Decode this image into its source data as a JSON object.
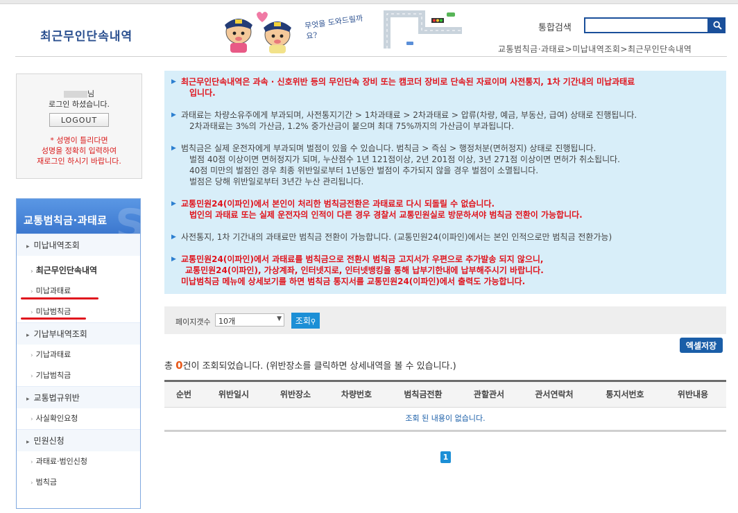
{
  "header": {
    "page_title": "최근무인단속내역",
    "search_label": "통합검색",
    "search_value": "",
    "mascot_text": "무엇을 도와드릴까요?",
    "breadcrumb": "교통범칙금·과태료>미납내역조회>최근무인단속내역"
  },
  "login": {
    "name_suffix": "님",
    "status": "로그인 하셨습니다.",
    "logout_label": "LOGOUT",
    "warning_lines": [
      "* 성명이 틀리다면",
      "성명을 정확히 입력하여",
      "재로그인 하시기 바랍니다."
    ]
  },
  "sidebar": {
    "title": "교통범칙금·과태료",
    "sections": [
      {
        "label": "미납내역조회",
        "items": [
          "최근무인단속내역",
          "미납과태료",
          "미납범칙금"
        ]
      },
      {
        "label": "기납부내역조회",
        "items": [
          "기납과태료",
          "기납범칙금"
        ]
      },
      {
        "label": "교통법규위반",
        "items": [
          "사실확인요청"
        ]
      },
      {
        "label": "민원신청",
        "items": [
          "과태료·범인신청",
          "범칙금"
        ]
      }
    ]
  },
  "notices": [
    {
      "style": "red",
      "lines": [
        "최근무인단속내역은 과속 · 신호위반 등의 무인단속 장비 또는 캠코더 장비로 단속된 자료이며 사전통지, 1차 기간내의 미납과태료",
        "입니다."
      ]
    },
    {
      "style": "gray",
      "lines": [
        "과태료는 차량소유주에게 부과되며, 사전통지기간 > 1차과태료 > 2차과태료 > 압류(차량, 예금, 부동산, 급여) 상태로 진행됩니다.",
        "2차과태료는 3%의 가산금, 1.2% 중가산금이 붙으며 최대 75%까지의 가산금이 부과됩니다."
      ]
    },
    {
      "style": "gray",
      "lines": [
        "범칙금은 실제 운전자에게 부과되며 벌점이 있을 수 있습니다. 범칙금 > 즉심 > 행정처분(면허정지) 상태로 진행됩니다.",
        "벌점 40점 이상이면 면허정지가 되며, 누산점수 1년 121점이상, 2년 201점 이상, 3년 271점 이상이면 면허가 취소됩니다.",
        "40점 미만의 벌점인 경우 최종 위반일로부터 1년동안 벌점이 추가되지 않을 경우 벌점이 소멸됩니다.",
        "벌점은 당해 위반일로부터 3년간 누산 관리됩니다."
      ]
    },
    {
      "style": "red",
      "lines": [
        "교통민원24(이파인)에서 본인이 처리한 범칙금전환은 과태료로 다시 되돌릴 수 없습니다.",
        "법인의 과태료 또는 실제 운전자의 인적이 다른 경우 경찰서 교통민원실로 방문하셔야 범칙금 전환이 가능합니다."
      ]
    },
    {
      "style": "gray",
      "lines": [
        "사전통지, 1차 기간내의 과태료만 범칙금 전환이 가능합니다. (교통민원24(이파인)에서는 본인 인적으로만 범칙금 전환가능)"
      ]
    },
    {
      "style": "red",
      "lines": [
        "교통민원24(이파인)에서 과태료를 범칙금으로 전환시 범칙금 고지서가 우편으로 추가발송 되지 않으니,",
        "교통민원24(이파인), 가상계좌, 인터넷지로, 인터넷뱅킹을 통해 납부기한내에 납부해주시기 바랍니다.",
        "미납범칙금 메뉴에 상세보기를 하면 범칙금 통지서를 교통민원24(이파인)에서 출력도 가능합니다."
      ]
    }
  ],
  "filter": {
    "label": "페이지갯수",
    "page_size": "10개",
    "search_button": "조회"
  },
  "excel_button": "엑셀저장",
  "result": {
    "prefix": "총 ",
    "count": "0",
    "suffix": "건이 조회되었습니다. (위반장소를 클릭하면 상세내역을 볼 수 있습니다.)"
  },
  "table": {
    "columns": [
      "순번",
      "위반일시",
      "위반장소",
      "차량번호",
      "범칙금전환",
      "관할관서",
      "관서연락처",
      "통지서번호",
      "위반내용"
    ],
    "empty_message": "조회 된 내용이 없습니다."
  },
  "pagination": {
    "current": "1"
  }
}
